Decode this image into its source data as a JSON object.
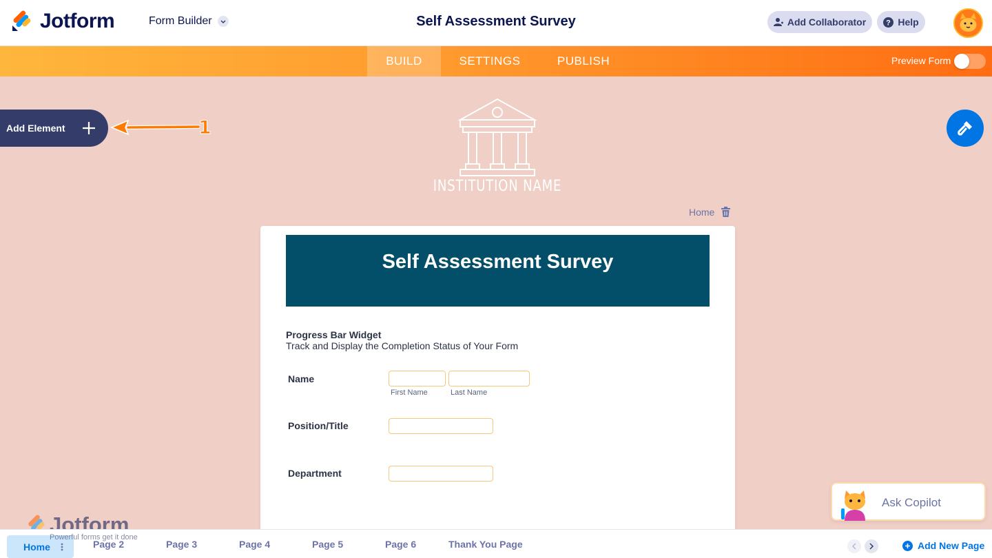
{
  "app": {
    "brand": "Jotform",
    "mode_selector": "Form Builder",
    "form_title": "Self Assessment Survey"
  },
  "header": {
    "add_collaborator": "Add Collaborator",
    "help": "Help"
  },
  "nav": {
    "tabs": [
      {
        "label": "BUILD",
        "active": true
      },
      {
        "label": "SETTINGS",
        "active": false
      },
      {
        "label": "PUBLISH",
        "active": false
      }
    ],
    "preview_label": "Preview Form",
    "preview_on": false
  },
  "sidebar": {
    "add_element": "Add Element"
  },
  "annotation": {
    "number": "1"
  },
  "canvas": {
    "institution_name": "INSTITUTION NAME",
    "page_label": "Home"
  },
  "form": {
    "heading": "Self Assessment Survey",
    "widget_title": "Progress Bar Widget",
    "widget_subtitle": "Track and Display the Completion Status of Your Form",
    "fields": {
      "name": {
        "label": "Name",
        "first_sublabel": "First Name",
        "last_sublabel": "Last Name"
      },
      "position": {
        "label": "Position/Title"
      },
      "department": {
        "label": "Department"
      }
    }
  },
  "pages": {
    "tabs": [
      "Home",
      "Page 2",
      "Page 3",
      "Page 4",
      "Page 5",
      "Page 6",
      "Thank You Page"
    ],
    "active": "Home",
    "add_new": "Add New Page"
  },
  "watermark": {
    "brand": "Jotform",
    "tagline": "Powerful forms get it done"
  },
  "copilot": {
    "label": "Ask Copilot"
  },
  "colors": {
    "accent": "#0075e3",
    "brand_orange": "#ff6100",
    "header_banner": "#034f6a",
    "canvas_bg": "#efcfc6"
  }
}
